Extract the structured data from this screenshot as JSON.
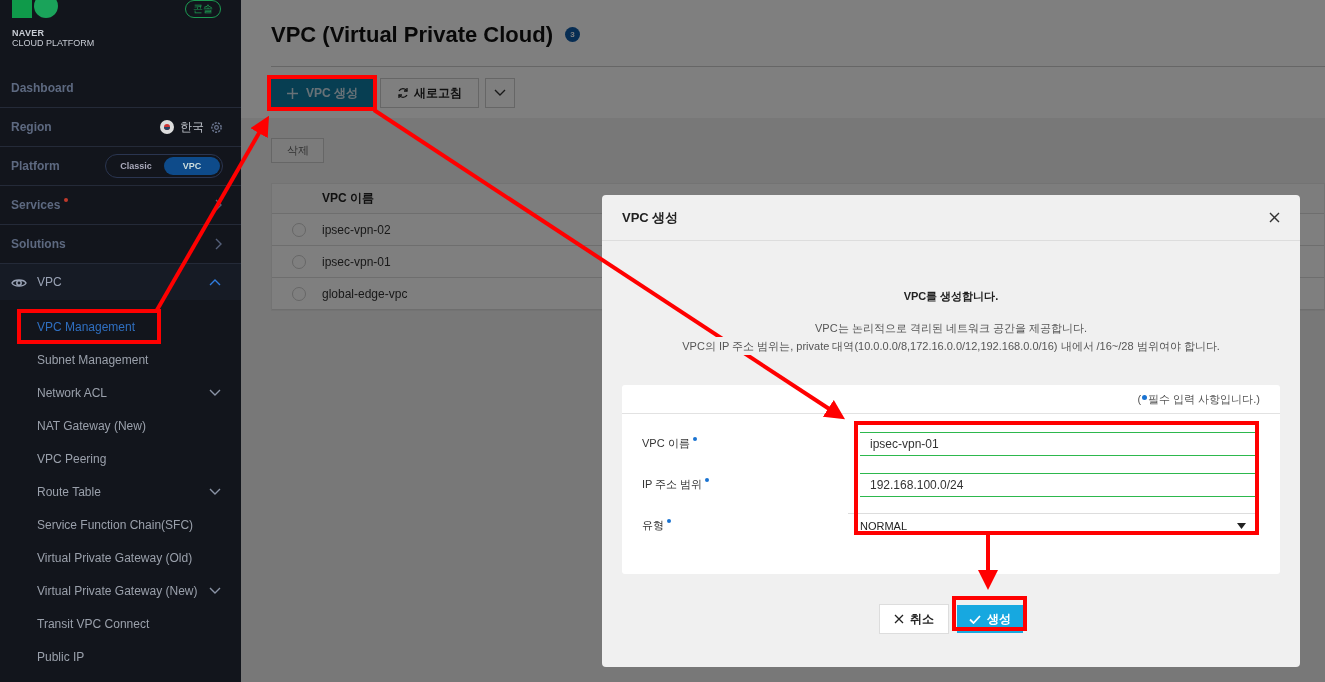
{
  "sidebar": {
    "logo": {
      "line_1": "NAVER",
      "line_2": "CLOUD PLATFORM"
    },
    "console_badge": "콘솔",
    "nav": [
      {
        "kind": "link",
        "label": "Dashboard"
      },
      {
        "kind": "region",
        "label": "Region",
        "value": "한국"
      },
      {
        "kind": "platform",
        "label": "Platform",
        "options": [
          {
            "label": "Classic",
            "selected": false
          },
          {
            "label": "VPC",
            "selected": true
          }
        ]
      },
      {
        "kind": "menu",
        "label": "Services",
        "notice": true
      },
      {
        "kind": "menu",
        "label": "Solutions",
        "notice": false
      }
    ],
    "section": {
      "label": "VPC",
      "expanded": true,
      "items": [
        {
          "label": "VPC Management",
          "selected": true,
          "expandable": false
        },
        {
          "label": "Subnet Management",
          "selected": false,
          "expandable": false
        },
        {
          "label": "Network ACL",
          "selected": false,
          "expandable": true
        },
        {
          "label": "NAT Gateway (New)",
          "selected": false,
          "expandable": false
        },
        {
          "label": "VPC Peering",
          "selected": false,
          "expandable": false
        },
        {
          "label": "Route Table",
          "selected": false,
          "expandable": true
        },
        {
          "label": "Service Function Chain(SFC)",
          "selected": false,
          "expandable": false
        },
        {
          "label": "Virtual Private Gateway (Old)",
          "selected": false,
          "expandable": false
        },
        {
          "label": "Virtual Private Gateway (New)",
          "selected": false,
          "expandable": true
        },
        {
          "label": "Transit VPC Connect",
          "selected": false,
          "expandable": false
        },
        {
          "label": "Public IP",
          "selected": false,
          "expandable": false
        }
      ]
    }
  },
  "page": {
    "title": "VPC (Virtual Private Cloud)",
    "count": "3",
    "toolbar": {
      "create": "VPC 생성",
      "refresh": "새로고침"
    },
    "delete_button": {
      "label": "삭제",
      "disabled": true
    },
    "table": {
      "columns": [
        "VPC 이름"
      ],
      "rows": [
        {
          "name": "ipsec-vpn-02",
          "selected": false
        },
        {
          "name": "ipsec-vpn-01",
          "selected": false
        },
        {
          "name": "global-edge-vpc",
          "selected": false
        }
      ]
    }
  },
  "modal": {
    "title": "VPC 생성",
    "heading": "VPC를 생성합니다.",
    "description": [
      "VPC는 논리적으로 격리된 네트워크 공간을 제공합니다.",
      "VPC의 IP 주소 범위는, private 대역(10.0.0.0/8,172.16.0.0/12,192.168.0.0/16) 내에서 /16~/28 범위여야 합니다."
    ],
    "required_note": {
      "before": "(",
      "text": "필수 입력 사항입니다.)"
    },
    "fields": [
      {
        "kind": "text",
        "label": "VPC 이름",
        "required": true,
        "value": "ipsec-vpn-01"
      },
      {
        "kind": "text",
        "label": "IP 주소 범위",
        "required": true,
        "value": "192.168.100.0/24"
      },
      {
        "kind": "select",
        "label": "유형",
        "required": true,
        "value": "NORMAL"
      }
    ],
    "cancel": "취소",
    "confirm": "생성"
  }
}
